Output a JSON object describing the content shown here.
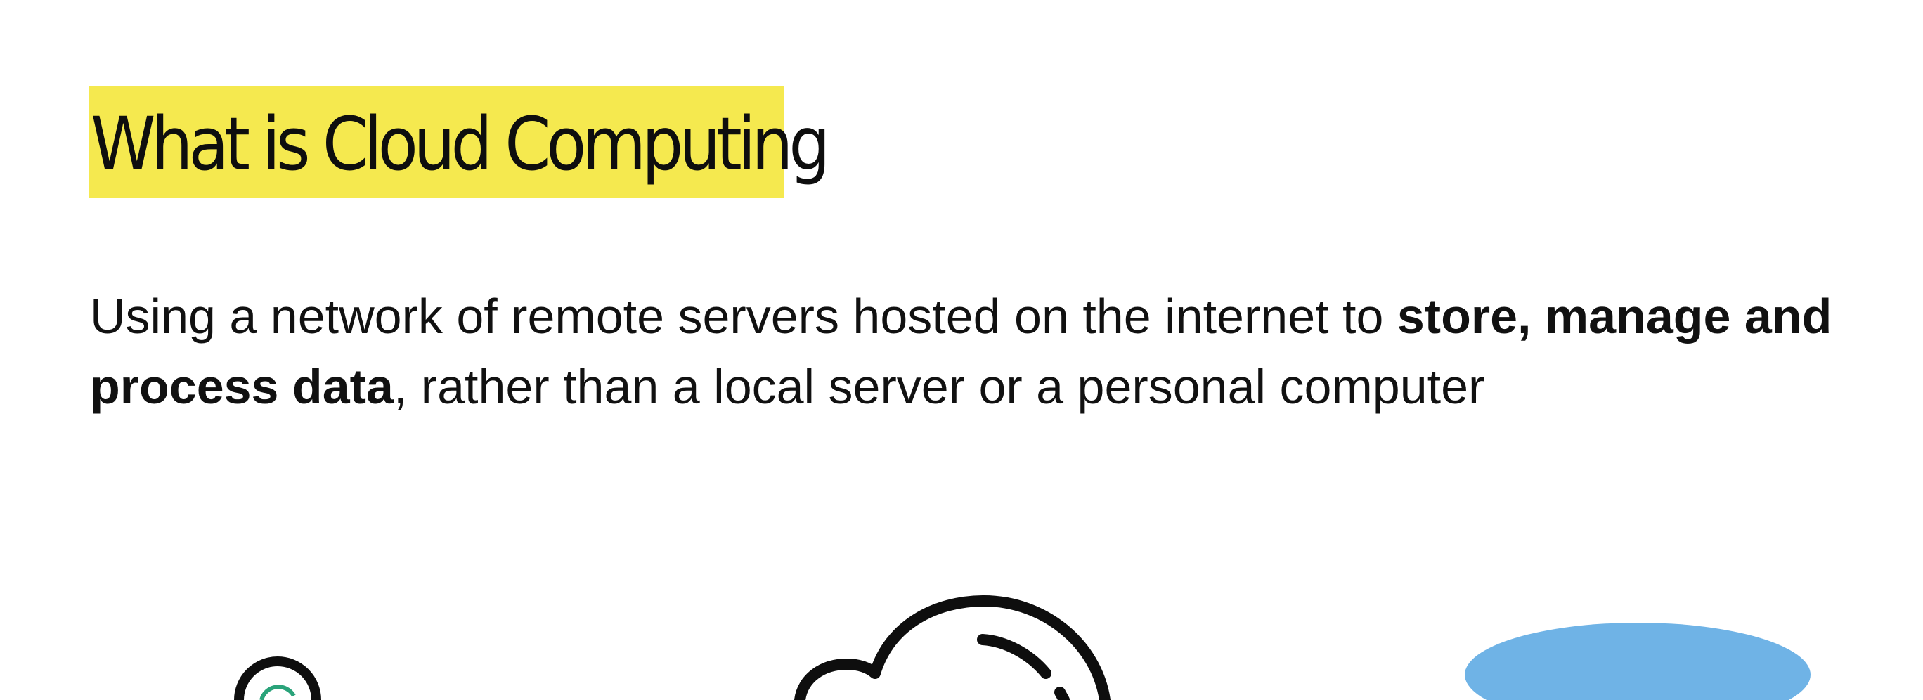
{
  "slide": {
    "title": "What is Cloud Computing",
    "highlight_color": "#f5e94f",
    "body": {
      "part1": "Using a network of remote servers hosted on the internet to ",
      "bold1": "store, manage and",
      "space": " ",
      "bold2": "process data",
      "part2": ", rather than a local server or a personal computer"
    },
    "illustrations": {
      "left_icon": "person-icon",
      "center_icon": "cloud-icon",
      "right_icon": "database-icon",
      "right_icon_color": "#6fb3e6"
    }
  }
}
